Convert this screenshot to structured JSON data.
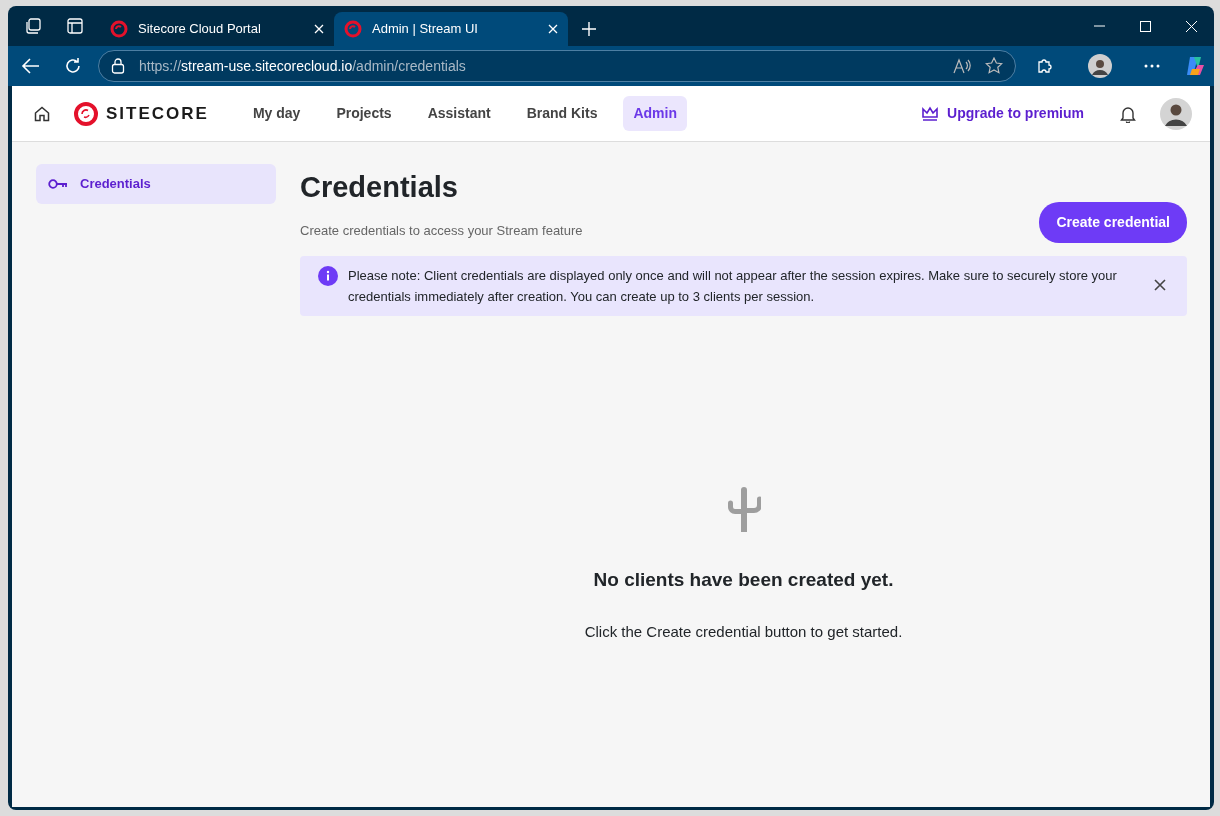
{
  "browser": {
    "tabs": [
      {
        "title": "Sitecore Cloud Portal",
        "selected": false
      },
      {
        "title": "Admin | Stream UI",
        "selected": true
      }
    ],
    "address": "https://stream-use.sitecorecloud.io/admin/credentials"
  },
  "header": {
    "logo": "SITECORE",
    "nav": [
      {
        "label": "My day",
        "selected": false
      },
      {
        "label": "Projects",
        "selected": false
      },
      {
        "label": "Assistant",
        "selected": false
      },
      {
        "label": "Brand Kits",
        "selected": false
      },
      {
        "label": "Admin",
        "selected": true
      }
    ],
    "upgrade": "Upgrade to premium"
  },
  "sidebar": {
    "items": [
      {
        "label": "Credentials",
        "selected": true
      }
    ]
  },
  "page": {
    "title": "Credentials",
    "subtitle": "Create credentials to access your Stream feature",
    "button": "Create credential",
    "alert": "Please note: Client credentials are displayed only once and will not appear after the session expires. Make sure to securely store your credentials immediately after creation. You can create up to 3 clients per session.",
    "empty_title": "No clients have been created yet.",
    "empty_text": "Click the Create credential button to get started."
  }
}
